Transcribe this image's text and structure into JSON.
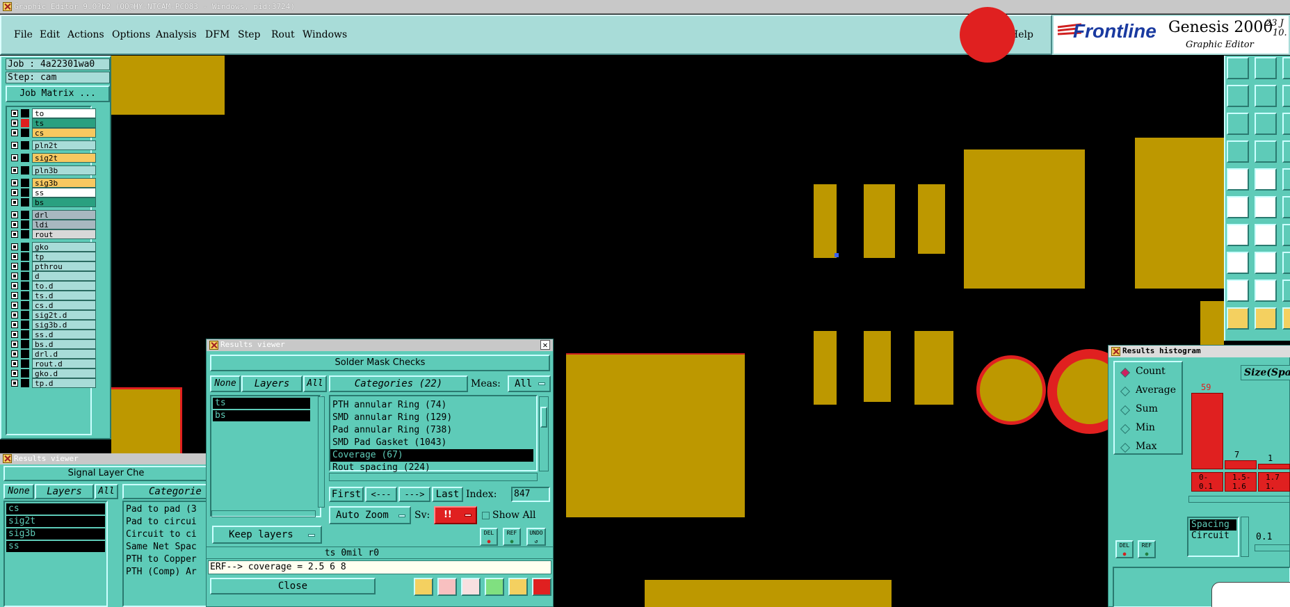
{
  "window_title": "Graphic Editor 9.0?b2 (OO@HY-NTCAM-PC083 - Windows, pid:3724)",
  "menu": [
    "File",
    "Edit",
    "Actions",
    "Options",
    "Analysis",
    "DFM",
    "Step",
    "Rout",
    "Windows"
  ],
  "help": "Help",
  "brand": {
    "logo": "Frontline",
    "product": "Genesis 2000",
    "subtitle": "Graphic Editor",
    "date_top": "23 J",
    "date_bot": "10."
  },
  "job": {
    "job_label": "Job : 4a22301wa0",
    "step_label": "Step: cam",
    "matrix_button": "Job Matrix ..."
  },
  "layers": [
    {
      "name": "to",
      "bg": "#ffffff"
    },
    {
      "name": "ts",
      "bg": "#2aa080",
      "active": true
    },
    {
      "name": "cs",
      "bg": "#f8c860"
    },
    {
      "name": "pln2t",
      "bg": "#a8dcd8"
    },
    {
      "name": "sig2t",
      "bg": "#f8c860"
    },
    {
      "name": "pln3b",
      "bg": "#a8dcd8"
    },
    {
      "name": "sig3b",
      "bg": "#f8c860"
    },
    {
      "name": "ss",
      "bg": "#ffffff"
    },
    {
      "name": "bs",
      "bg": "#2aa080"
    },
    {
      "name": "drl",
      "bg": "#a8b8c0"
    },
    {
      "name": "ldi",
      "bg": "#a8b8c0"
    },
    {
      "name": "rout",
      "bg": "#d8d8d8"
    },
    {
      "name": "gko",
      "bg": "#a8dcd8"
    },
    {
      "name": "tp",
      "bg": "#a8dcd8"
    },
    {
      "name": "pthrou",
      "bg": "#a8dcd8"
    },
    {
      "name": "d",
      "bg": "#a8dcd8"
    },
    {
      "name": "to.d",
      "bg": "#a8dcd8"
    },
    {
      "name": "ts.d",
      "bg": "#a8dcd8"
    },
    {
      "name": "cs.d",
      "bg": "#a8dcd8"
    },
    {
      "name": "sig2t.d",
      "bg": "#a8dcd8"
    },
    {
      "name": "sig3b.d",
      "bg": "#a8dcd8"
    },
    {
      "name": "ss.d",
      "bg": "#a8dcd8"
    },
    {
      "name": "bs.d",
      "bg": "#a8dcd8"
    },
    {
      "name": "drl.d",
      "bg": "#a8dcd8"
    },
    {
      "name": "rout.d",
      "bg": "#a8dcd8"
    },
    {
      "name": "gko.d",
      "bg": "#a8dcd8"
    },
    {
      "name": "tp.d",
      "bg": "#a8dcd8"
    }
  ],
  "results_viewer_main": {
    "title": "Results viewer",
    "check_name": "Solder Mask Checks",
    "none": "None",
    "layers": "Layers",
    "all": "All",
    "categories_label": "Categories (22)",
    "meas_label": "Meas:",
    "meas_value": "All",
    "selected_layers": [
      "ts",
      "bs"
    ],
    "categories": [
      {
        "text": "PTH annular Ring (74)"
      },
      {
        "text": "SMD annular Ring (129)"
      },
      {
        "text": "Pad annular Ring (738)"
      },
      {
        "text": "SMD Pad Gasket (1043)"
      },
      {
        "text": "Coverage (67)",
        "selected": true
      },
      {
        "text": "Rout spacing (224)"
      }
    ],
    "first": "First",
    "prev": "<---",
    "next": "--->",
    "last": "Last",
    "index_label": "Index:",
    "index_value": "847",
    "auto_zoom": "Auto Zoom",
    "sv_label": "Sv:",
    "sv_value": "!!",
    "show_all": "Show All",
    "keep_layers": "Keep layers",
    "del": "DEL",
    "ref": "REF",
    "undo": "UNDO",
    "status": "ts  0mil  r0",
    "erf": "ERF--> coverage = 2.5 6 8",
    "close": "Close"
  },
  "results_viewer_back": {
    "title": "Results viewer",
    "check_name": "Signal Layer Che",
    "none": "None",
    "layers": "Layers",
    "all": "All",
    "categories_label": "Categorie",
    "selected_layers": [
      "cs",
      "sig2t",
      "sig3b",
      "ss"
    ],
    "categories": [
      "Pad to pad (3",
      "Pad to circui",
      "Circuit to ci",
      "Same Net Spac",
      "PTH to Copper",
      "PTH (Comp) Ar"
    ]
  },
  "histogram": {
    "title": "Results histogram",
    "modes": [
      {
        "label": "Count",
        "on": true
      },
      {
        "label": "Average"
      },
      {
        "label": "Sum"
      },
      {
        "label": "Min"
      },
      {
        "label": "Max"
      }
    ],
    "size_label": "Size(Spa",
    "bars": [
      {
        "count": "59",
        "value": 59
      },
      {
        "count": "7",
        "value": 7
      },
      {
        "count": "1",
        "value": 1
      }
    ],
    "ranges": [
      [
        "0-",
        "0.1"
      ],
      [
        "1.5-",
        "1.6"
      ],
      [
        "1.7",
        "1."
      ]
    ],
    "list_items": [
      "Spacing",
      "Circuit"
    ],
    "scale_value": "0.1",
    "del": "DEL",
    "ref": "REF"
  }
}
